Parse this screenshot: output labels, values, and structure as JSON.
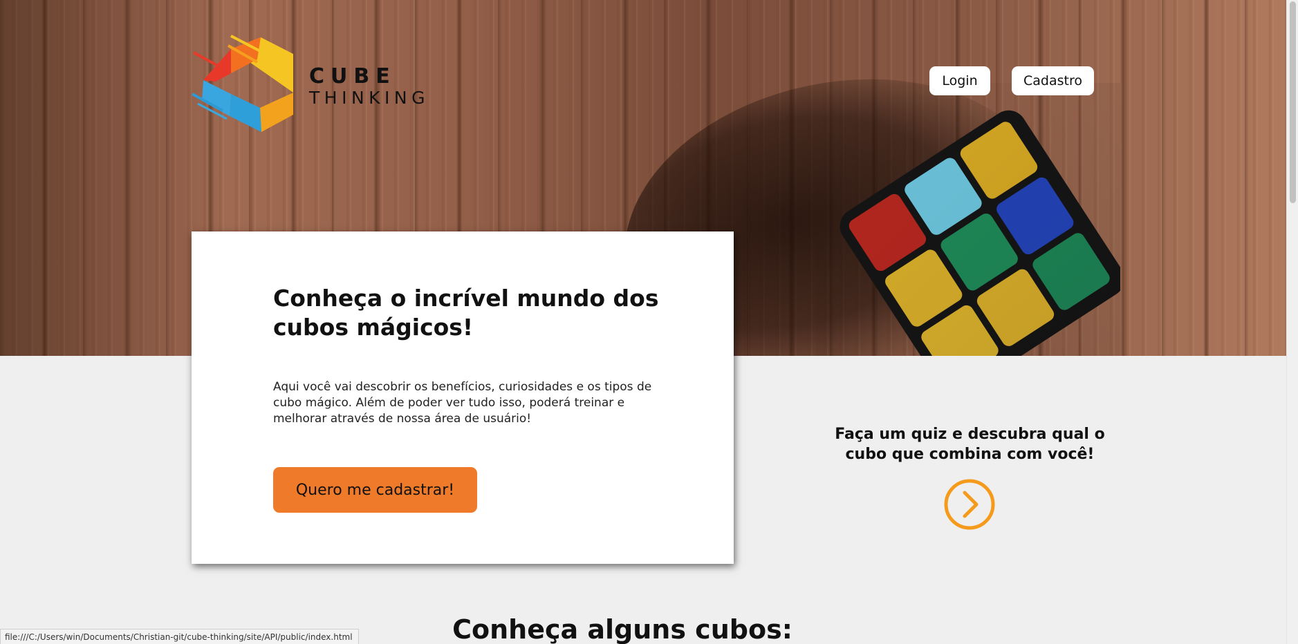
{
  "brand": {
    "line1": "CUBE",
    "line2": "THINKING"
  },
  "nav": {
    "login_label": "Login",
    "signup_label": "Cadastro"
  },
  "hero_card": {
    "title": "Conheça o incrível mundo dos cubos mágicos!",
    "description": "Aqui você vai descobrir os benefícios, curiosidades e os tipos de cubo mágico. Além de poder ver tudo isso, poderá treinar e melhorar através de nossa área de usuário!",
    "cta_label": "Quero me cadastrar!"
  },
  "quiz": {
    "text": "Faça um quiz e descubra qual o cubo que combina com você!",
    "arrow_icon": "chevron-right-circle-icon"
  },
  "cubes_section": {
    "heading": "Conheça alguns cubos:"
  },
  "status_bar": {
    "url": "file:///C:/Users/win/Documents/Christian-git/cube-thinking/site/API/public/index.html"
  },
  "colors": {
    "accent": "#ee7a2a",
    "quiz_arrow": "#f59a1b",
    "page_background": "#efefef",
    "card_background": "#ffffff"
  }
}
